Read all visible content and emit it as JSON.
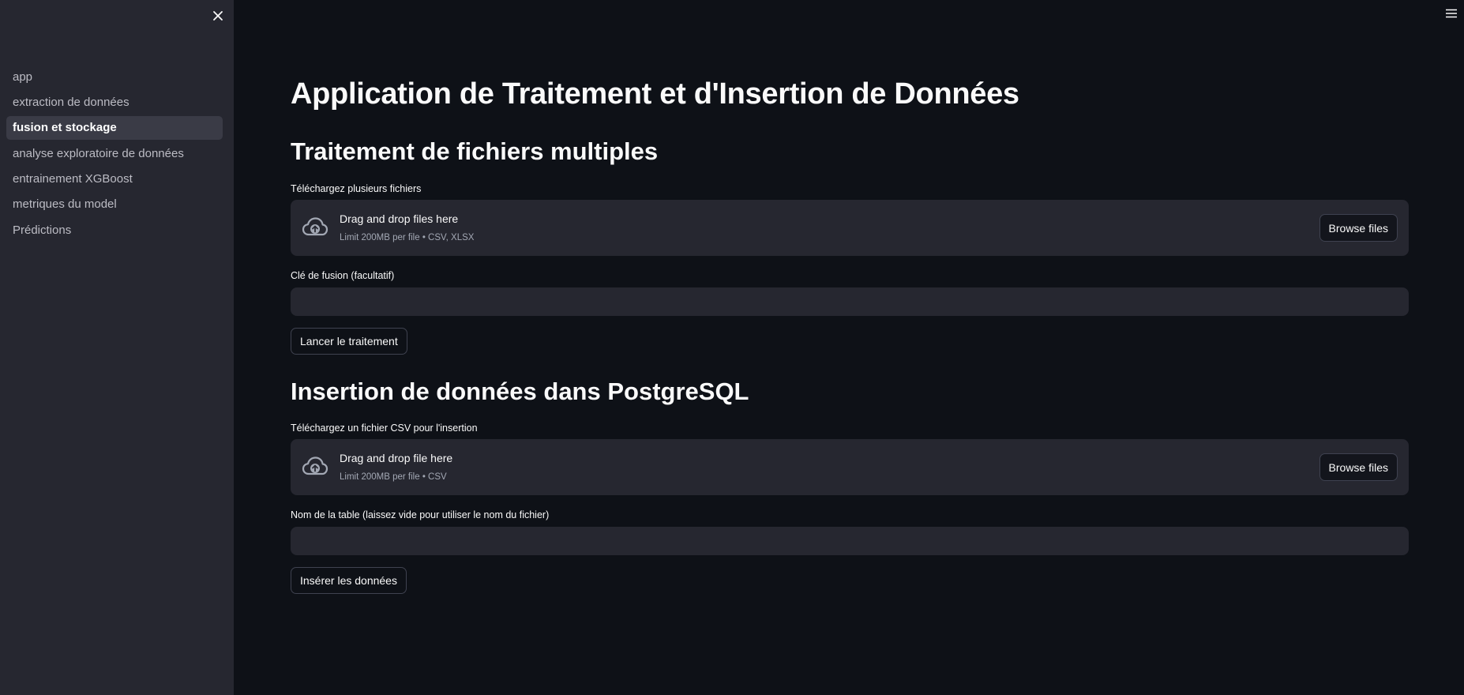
{
  "sidebar": {
    "items": [
      {
        "label": "app"
      },
      {
        "label": "extraction de données"
      },
      {
        "label": "fusion et stockage"
      },
      {
        "label": "analyse exploratoire de données"
      },
      {
        "label": "entrainement XGBoost"
      },
      {
        "label": "metriques du model"
      },
      {
        "label": "Prédictions"
      }
    ],
    "active_item": "fusion et stockage"
  },
  "page": {
    "title": "Application de Traitement et d'Insertion de Données"
  },
  "section_merge": {
    "heading": "Traitement de fichiers multiples",
    "uploader": {
      "label": "Téléchargez plusieurs fichiers",
      "drop_text": "Drag and drop files here",
      "limit_text": "Limit 200MB per file • CSV, XLSX",
      "browse_label": "Browse files"
    },
    "merge_key": {
      "label": "Clé de fusion (facultatif)",
      "value": ""
    },
    "run_button_label": "Lancer le traitement"
  },
  "section_insert": {
    "heading": "Insertion de données dans PostgreSQL",
    "uploader": {
      "label": "Téléchargez un fichier CSV pour l'insertion",
      "drop_text": "Drag and drop file here",
      "limit_text": "Limit 200MB per file • CSV",
      "browse_label": "Browse files"
    },
    "table_name": {
      "label": "Nom de la table (laissez vide pour utiliser le nom du fichier)",
      "value": ""
    },
    "insert_button_label": "Insérer les données"
  },
  "icons": {
    "sidebar_close": "close-icon",
    "main_menu": "hamburger-menu-icon",
    "uploader": "cloud-upload-icon"
  },
  "colors": {
    "background": "#0e1117",
    "sidebar": "#262730",
    "widget": "#262730",
    "text": "#fafafa",
    "muted_text": "#a3a8b4"
  }
}
